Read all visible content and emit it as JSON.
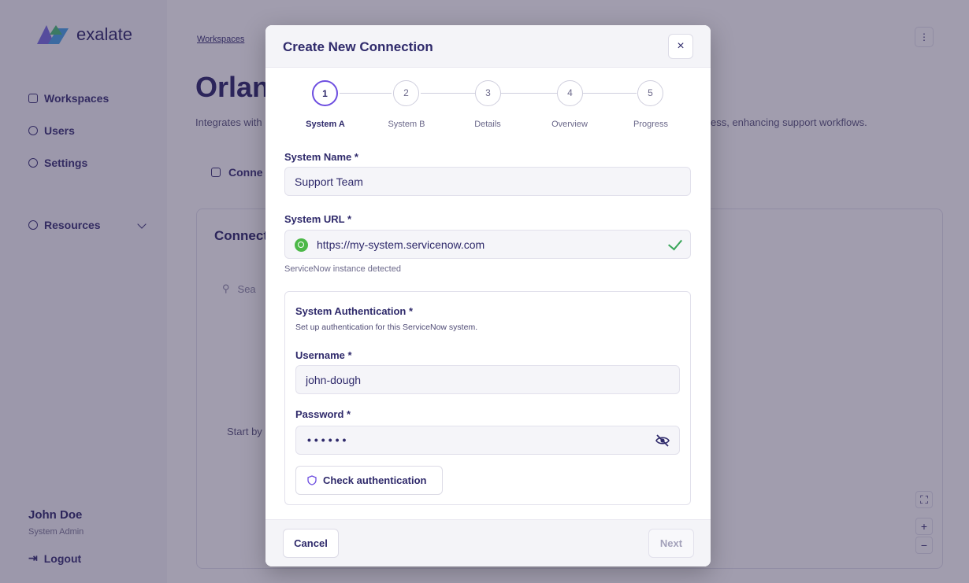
{
  "app": {
    "logo_text": "exalate",
    "sidebar": {
      "items": [
        {
          "label": "Workspaces"
        },
        {
          "label": "Users"
        },
        {
          "label": "Settings"
        },
        {
          "label": "Resources"
        }
      ],
      "user_name": "John Doe",
      "user_role": "System Admin",
      "logout_label": "Logout"
    },
    "main": {
      "breadcrumb": "Workspaces",
      "title": "Orlan",
      "subtitle_left": "Integrates with",
      "subtitle_right": "ess, enhancing support workflows.",
      "tab_label": "Conne",
      "panel_title": "Connecti",
      "search_placeholder": "Sea",
      "empty_text": "Start by"
    }
  },
  "modal": {
    "title": "Create New Connection",
    "close_label": "×",
    "steps": [
      {
        "number": "1",
        "label": "System A"
      },
      {
        "number": "2",
        "label": "System B"
      },
      {
        "number": "3",
        "label": "Details"
      },
      {
        "number": "4",
        "label": "Overview"
      },
      {
        "number": "5",
        "label": "Progress"
      }
    ],
    "system_name_label": "System Name *",
    "system_name_value": "Support Team",
    "system_url_label": "System URL *",
    "system_url_value": "https://my-system.servicenow.com",
    "url_hint": "ServiceNow instance detected",
    "auth": {
      "title": "System Authentication *",
      "description": "Set up authentication for this ServiceNow system.",
      "username_label": "Username *",
      "username_value": "john-dough",
      "password_label": "Password *",
      "password_mask": "••••••",
      "check_button": "Check authentication"
    },
    "cancel_label": "Cancel",
    "next_label": "Next"
  },
  "colors": {
    "accent": "#6d4ee0",
    "text_primary": "#2f2a6b",
    "success": "#3aa65a",
    "servicenow_green": "#4cb848"
  }
}
